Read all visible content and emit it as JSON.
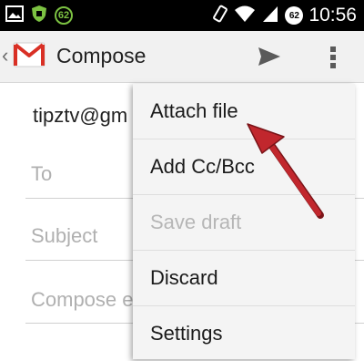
{
  "status_bar": {
    "time": "10:56",
    "battery_badge": "62",
    "icons": [
      "image-icon",
      "shield-icon",
      "battery-badge-icon",
      "vibrate-icon",
      "wifi-icon",
      "signal-icon",
      "battery-percent-icon"
    ]
  },
  "action_bar": {
    "title": "Compose",
    "icons": [
      "up-caret-icon",
      "gmail-icon",
      "send-icon",
      "overflow-menu-icon"
    ]
  },
  "compose": {
    "from": "tipztv@gm",
    "to_placeholder": "To",
    "subject_placeholder": "Subject",
    "body_placeholder": "Compose e"
  },
  "menu": {
    "items": [
      {
        "label": "Attach file",
        "enabled": true
      },
      {
        "label": "Add Cc/Bcc",
        "enabled": true
      },
      {
        "label": "Save draft",
        "enabled": false
      },
      {
        "label": "Discard",
        "enabled": true
      },
      {
        "label": "Settings",
        "enabled": true
      }
    ]
  },
  "colors": {
    "status_bar_bg": "#000000",
    "action_bar_bg": "#f1f1f1",
    "menu_bg": "#f4f4f4",
    "disabled_text": "#b6b6b6",
    "annotation_arrow": "#c1272d",
    "gmail_red": "#d93025"
  }
}
